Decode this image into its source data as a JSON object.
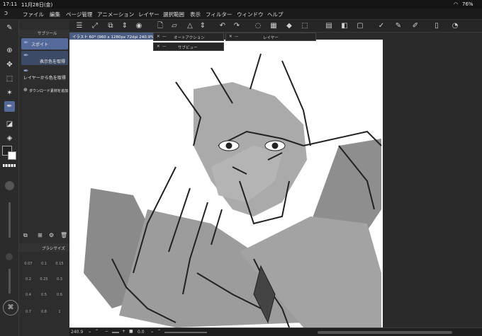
{
  "status": {
    "time": "17:11",
    "date": "11月28日(金)",
    "battery": "76%"
  },
  "menu": [
    "ファイル",
    "編集",
    "ページ管理",
    "アニメーション",
    "レイヤー",
    "選択範囲",
    "表示",
    "フィルター",
    "ウィンドウ",
    "ヘルプ"
  ],
  "subtool": {
    "header": "サブツール",
    "items": [
      "スポイト",
      "表示色を取得",
      "レイヤーから色を取得"
    ],
    "download": "ダウンロード素材を追加"
  },
  "canvas": {
    "tab_title": "イラスト 60* (960 x 1280px 72dpi 240.9%)"
  },
  "panels": {
    "auto_action": "オートアクション",
    "sub_view": "サブビュー",
    "layer": "レイヤー"
  },
  "brush_size": {
    "title": "ブラシサイズ",
    "values": [
      "0.07",
      "0.1",
      "0.15",
      "0.2",
      "0.25",
      "0.3",
      "0.4",
      "0.5",
      "0.6",
      "0.7",
      "0.8",
      "1"
    ]
  },
  "bottom": {
    "zoom": "240.9",
    "angle": "0.0"
  },
  "colors": {
    "accent": "#4a5c80",
    "selected_item": "#556a9a",
    "paper": "#ffffff"
  }
}
